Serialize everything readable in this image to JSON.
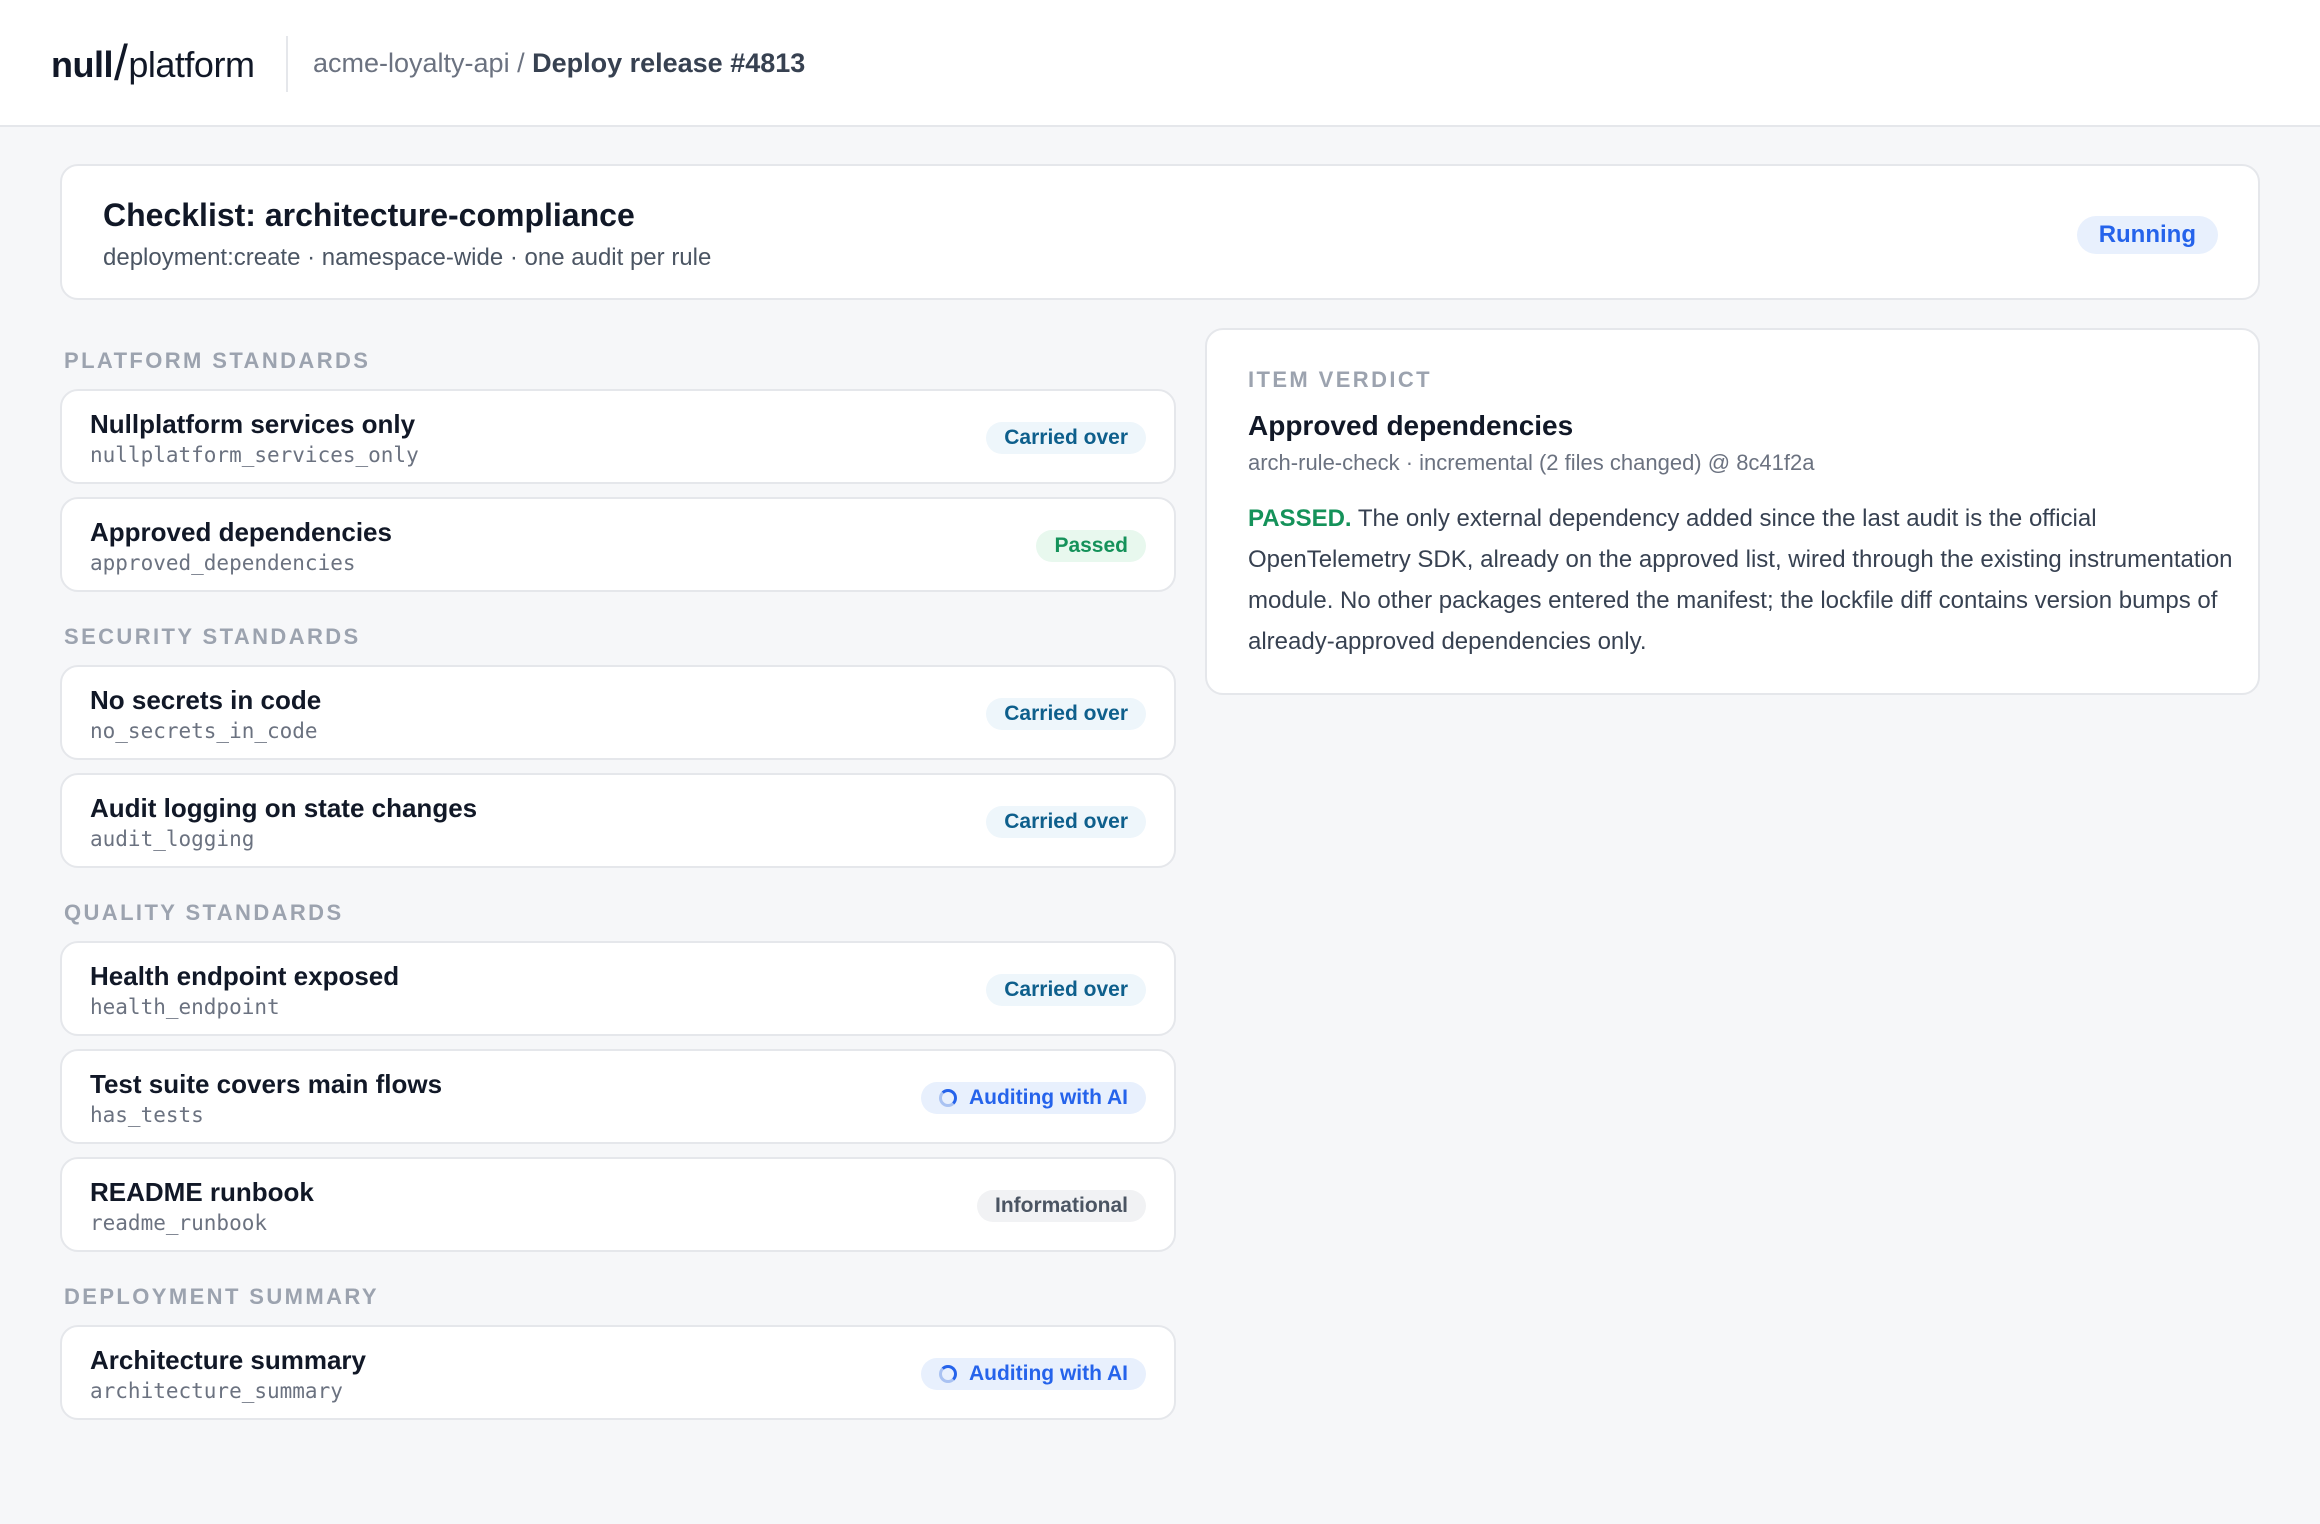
{
  "brand": {
    "part1": "null",
    "part2": "platform"
  },
  "breadcrumb": {
    "project": "acme-loyalty-api",
    "separator": " / ",
    "current": "Deploy release #4813"
  },
  "checklist": {
    "title": "Checklist: architecture-compliance",
    "subtitle": "deployment:create · namespace-wide · one audit per rule",
    "status": "Running"
  },
  "sections": [
    {
      "label": "PLATFORM STANDARDS",
      "items": [
        {
          "name": "Nullplatform services only",
          "key": "nullplatform_services_only",
          "status": "Carried over"
        },
        {
          "name": "Approved dependencies",
          "key": "approved_dependencies",
          "status": "Passed"
        }
      ]
    },
    {
      "label": "SECURITY STANDARDS",
      "items": [
        {
          "name": "No secrets in code",
          "key": "no_secrets_in_code",
          "status": "Carried over"
        },
        {
          "name": "Audit logging on state changes",
          "key": "audit_logging",
          "status": "Carried over"
        }
      ]
    },
    {
      "label": "QUALITY STANDARDS",
      "items": [
        {
          "name": "Health endpoint exposed",
          "key": "health_endpoint",
          "status": "Carried over"
        },
        {
          "name": "Test suite covers main flows",
          "key": "has_tests",
          "status": "Auditing with AI"
        },
        {
          "name": "README runbook",
          "key": "readme_runbook",
          "status": "Informational"
        }
      ]
    },
    {
      "label": "DEPLOYMENT SUMMARY",
      "items": [
        {
          "name": "Architecture summary",
          "key": "architecture_summary",
          "status": "Auditing with AI"
        }
      ]
    }
  ],
  "verdict": {
    "label": "ITEM VERDICT",
    "title": "Approved dependencies",
    "meta": "arch-rule-check · incremental (2 files changed) @ 8c41f2a",
    "status": "PASSED.",
    "body": " The only external dependency added since the last audit is the official OpenTelemetry SDK, already on the approved list, wired through the existing instrumentation module. No other packages entered the manifest; the lockfile diff contains version bumps of already-approved dependencies only."
  },
  "colors": {
    "accent": "#2563eb",
    "passed": "#15925a",
    "carried": "#0e5f8c",
    "muted": "#9ca3af"
  }
}
